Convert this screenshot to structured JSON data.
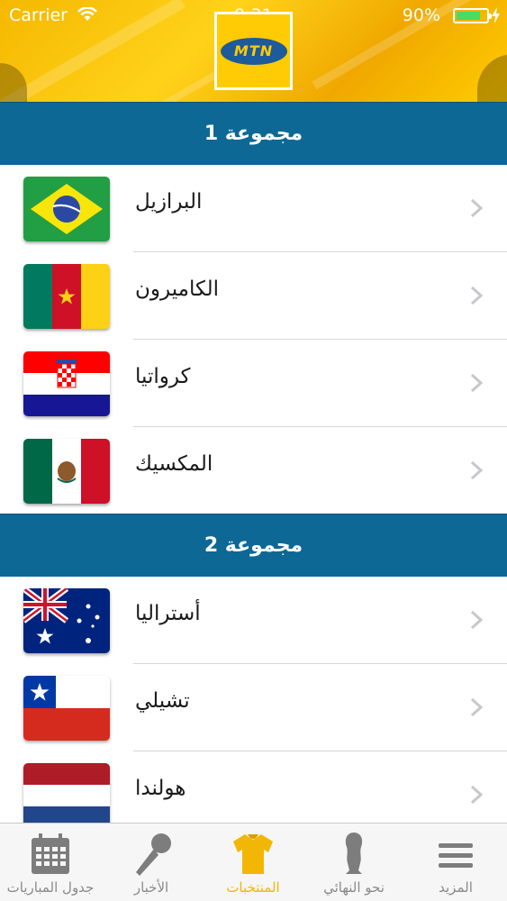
{
  "status_bar": {
    "carrier": "Carrier",
    "time": "9:31",
    "battery_percent": "90%",
    "battery_level": 0.9
  },
  "header": {
    "logo_text": "MTN",
    "colors": {
      "background": "#ffcb05",
      "logo_oval": "#1d5b9a"
    }
  },
  "groups": [
    {
      "title": "مجموعة 1",
      "teams": [
        {
          "name": "البرازيل",
          "flag": "brazil-flag"
        },
        {
          "name": "الكاميرون",
          "flag": "cameroon-flag"
        },
        {
          "name": "كرواتيا",
          "flag": "croatia-flag"
        },
        {
          "name": "المكسيك",
          "flag": "mexico-flag"
        }
      ]
    },
    {
      "title": "مجموعة 2",
      "teams": [
        {
          "name": "أستراليا",
          "flag": "australia-flag"
        },
        {
          "name": "تشيلي",
          "flag": "chile-flag"
        },
        {
          "name": "هولندا",
          "flag": "netherlands-flag"
        }
      ]
    }
  ],
  "tabbar": {
    "active_color": "#f2b705",
    "tabs": [
      {
        "label": "جدول المباريات",
        "icon": "calendar-icon",
        "active": false
      },
      {
        "label": "الأخبار",
        "icon": "microphone-icon",
        "active": false
      },
      {
        "label": "المنتخبات",
        "icon": "jersey-icon",
        "active": true
      },
      {
        "label": "نحو النهائي",
        "icon": "trophy-icon",
        "active": false
      },
      {
        "label": "المزيد",
        "icon": "menu-icon",
        "active": false
      }
    ]
  },
  "colors": {
    "group_header": "#0e6895",
    "divider": "#d6d6d6"
  }
}
